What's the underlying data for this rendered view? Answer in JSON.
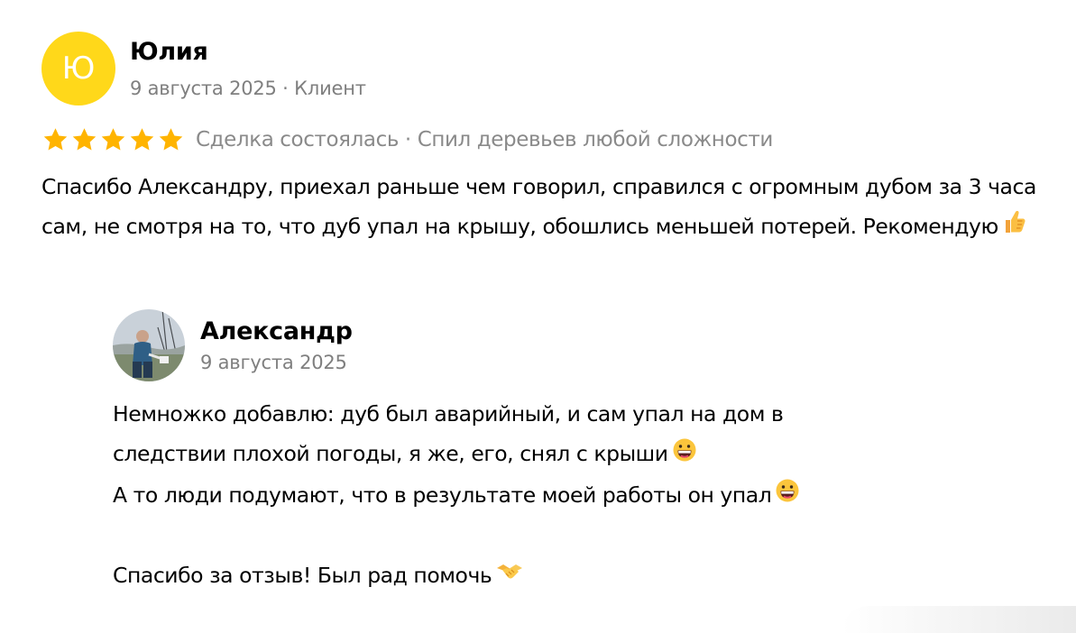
{
  "review": {
    "avatar_letter": "Ю",
    "author_name": "Юлия",
    "author_meta": "9 августа 2025 · Клиент",
    "rating": 5,
    "rating_max": 5,
    "star_color": "#ffb400",
    "rating_text": "Сделка состоялась · Спил деревьев любой сложности",
    "text": "Спасибо Александру, приехал раньше чем говорил, справился с огромным дубом за 3 часа сам, не смотря на то, что дуб упал на крышу, обошлись меньшей потерей. Рекомендую",
    "text_emoji": "thumbs-up-emoji"
  },
  "reply": {
    "author_name": "Александр",
    "date": "9 августа 2025",
    "lines": [
      {
        "text": "Немножко добавлю: дуб был аварийный, и сам упал на дом в",
        "emoji": ""
      },
      {
        "text": "следствии плохой погоды, я же, его, снял с крыши",
        "emoji": "grinning-face-emoji"
      },
      {
        "text": "А то люди подумают, что в результате моей работы он упал",
        "emoji": "grinning-face-emoji"
      },
      {
        "text": "",
        "emoji": ""
      },
      {
        "text": "Спасибо за отзыв! Был рад помочь",
        "emoji": "handshake-emoji"
      }
    ]
  },
  "colors": {
    "avatar_bg": "#ffd81a",
    "meta_text": "#7f7f7f"
  }
}
